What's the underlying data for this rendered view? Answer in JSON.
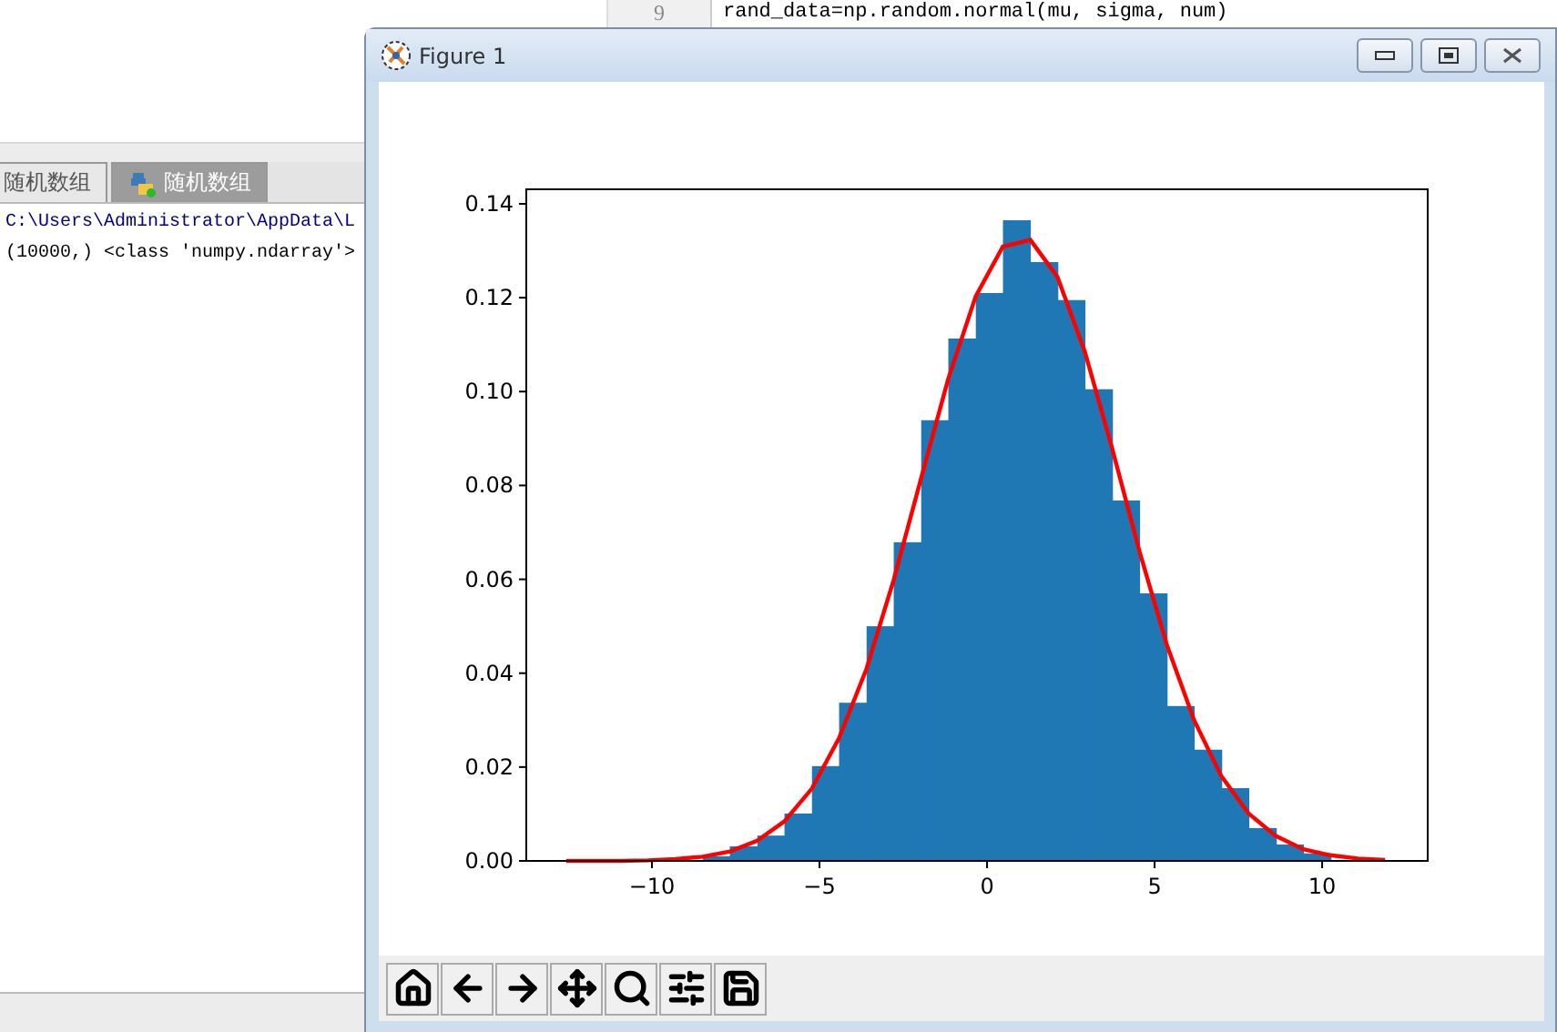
{
  "ide": {
    "gutter": [
      "9"
    ],
    "code_lines": [
      "rand_data=np.random.normal(mu, sigma, num)"
    ],
    "tabs": [
      {
        "label": "随机数组",
        "selected": false,
        "icon": false
      },
      {
        "label": "随机数组",
        "selected": true,
        "icon": true
      }
    ],
    "console_lines": [
      {
        "kind": "path",
        "text": "C:\\Users\\Administrator\\AppData\\L"
      },
      {
        "kind": "output",
        "text": "(10000,) <class 'numpy.ndarray'>"
      }
    ]
  },
  "figure_window": {
    "title": "Figure 1",
    "chart_data": {
      "type": "bar",
      "xlim": [
        -13.75,
        13.15
      ],
      "ylim": [
        0,
        0.1431
      ],
      "xticks": [
        {
          "value": -10,
          "label": "−10"
        },
        {
          "value": -5,
          "label": "−5"
        },
        {
          "value": 0,
          "label": "0"
        },
        {
          "value": 5,
          "label": "5"
        },
        {
          "value": 10,
          "label": "10"
        }
      ],
      "yticks": [
        {
          "value": 0,
          "label": "0.00"
        },
        {
          "value": 0.02,
          "label": "0.02"
        },
        {
          "value": 0.04,
          "label": "0.04"
        },
        {
          "value": 0.06,
          "label": "0.06"
        },
        {
          "value": 0.08,
          "label": "0.08"
        },
        {
          "value": 0.1,
          "label": "0.10"
        },
        {
          "value": 0.12,
          "label": "0.12"
        },
        {
          "value": 0.14,
          "label": "0.14"
        }
      ],
      "x": [
        -8.08,
        -7.27,
        -6.45,
        -5.64,
        -4.82,
        -4.01,
        -3.19,
        -2.38,
        -1.56,
        -0.75,
        0.07,
        0.88,
        1.7,
        2.51,
        3.33,
        4.14,
        4.96,
        5.77,
        6.59,
        7.4,
        8.22,
        9.03,
        9.85
      ],
      "series": [
        {
          "color": "#1f77b4",
          "values": [
            0.001,
            0.0031,
            0.0054,
            0.0101,
            0.0202,
            0.0337,
            0.05,
            0.0679,
            0.0939,
            0.1113,
            0.121,
            0.1365,
            0.1276,
            0.1195,
            0.1005,
            0.0768,
            0.057,
            0.033,
            0.0237,
            0.0155,
            0.007,
            0.0035,
            0.0016
          ]
        },
        {
          "type": "line",
          "color": "#ff0000",
          "x": [
            -12.56,
            -11.75,
            -10.93,
            -10.12,
            -9.3,
            -8.49,
            -7.67,
            -6.86,
            -6.05,
            -5.23,
            -4.42,
            -3.6,
            -2.79,
            -1.97,
            -1.16,
            -0.34,
            0.47,
            1.29,
            2.1,
            2.92,
            3.73,
            4.55,
            5.36,
            6.18,
            6.99,
            7.81,
            8.62,
            9.44,
            10.25,
            11.07,
            11.88
          ],
          "values": [
            0,
            0,
            0,
            0.0001,
            0.0004,
            0.0009,
            0.002,
            0.0043,
            0.0084,
            0.0154,
            0.0261,
            0.0409,
            0.0598,
            0.0815,
            0.1027,
            0.1203,
            0.1309,
            0.1323,
            0.1244,
            0.1084,
            0.0879,
            0.066,
            0.0461,
            0.03,
            0.0181,
            0.0101,
            0.0053,
            0.0025,
            0.0012,
            0.0005,
            0.0002
          ]
        }
      ]
    }
  }
}
